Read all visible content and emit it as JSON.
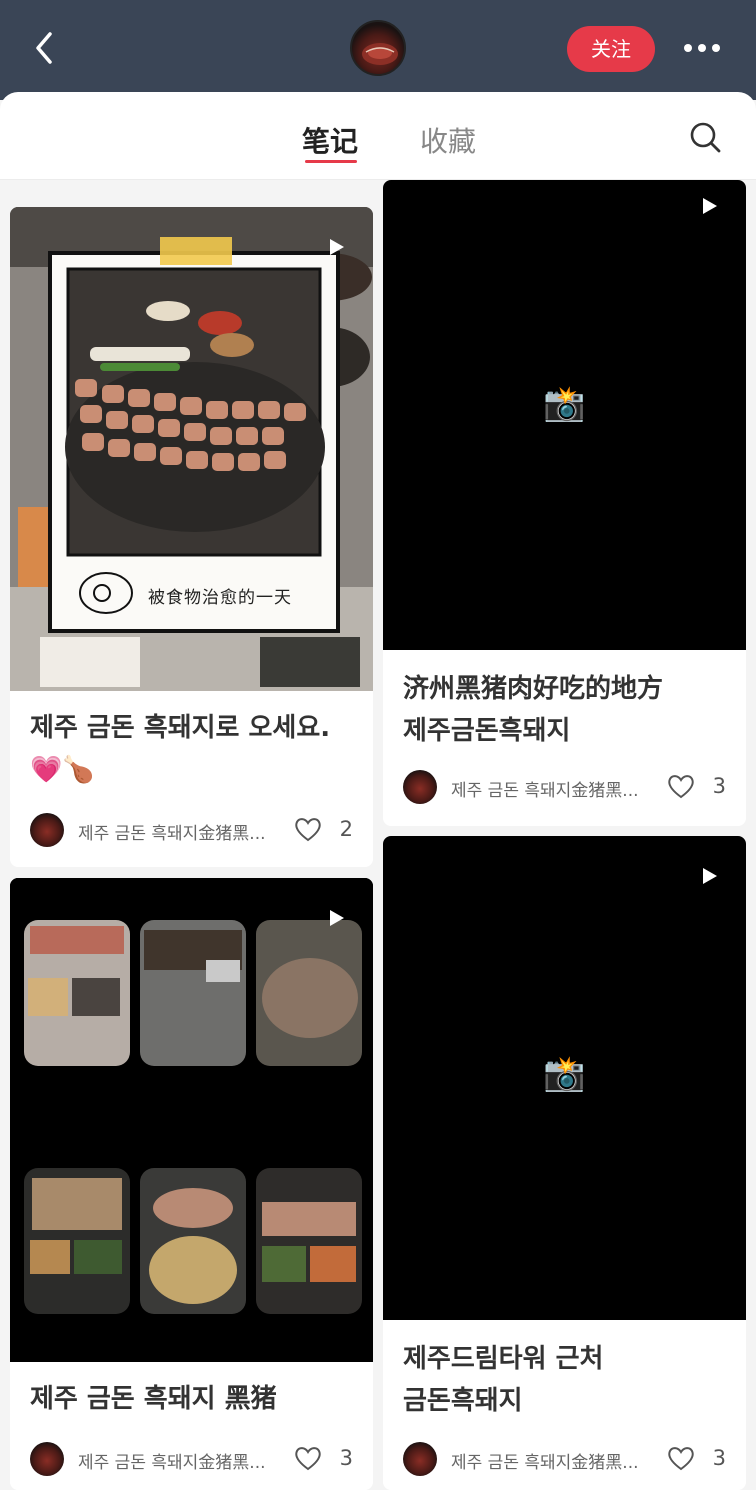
{
  "header": {
    "follow_label": "关注"
  },
  "tabs": {
    "notes": "笔记",
    "favorites": "收藏"
  },
  "posts": [
    {
      "title_line1": "제주 금돈 흑돼지로 오세요.",
      "title_line2": "💗🍗",
      "author": "제주 금돈 흑돼지金猪黑...",
      "likes": "2",
      "photo_caption": "被食物治愈的一天"
    },
    {
      "title_line1": "济州黑猪肉好吃的地方",
      "title_line2": "제주금돈흑돼지",
      "author": "제주 금돈 흑돼지金猪黑...",
      "likes": "3",
      "cover_icon": "📸"
    },
    {
      "title_line1": "제주 금돈 흑돼지 黑猪",
      "author": "제주 금돈 흑돼지金猪黑...",
      "likes": "3"
    },
    {
      "title_line1": "제주드림타워 근처",
      "title_line2": "금돈흑돼지",
      "author": "제주 금돈 흑돼지金猪黑...",
      "likes": "3",
      "cover_icon": "📸"
    }
  ]
}
